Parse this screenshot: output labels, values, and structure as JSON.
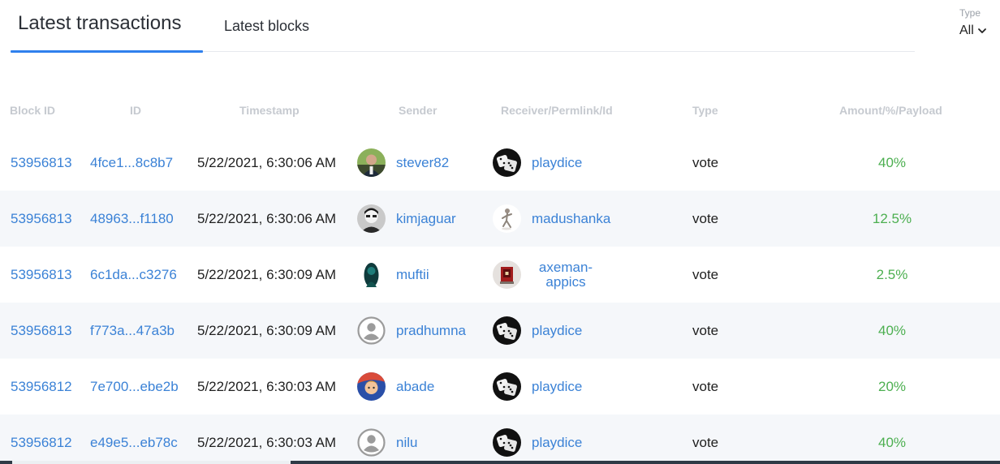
{
  "tabs": {
    "transactions": "Latest transactions",
    "blocks": "Latest blocks"
  },
  "filter": {
    "label": "Type",
    "value": "All"
  },
  "columns": [
    "Block ID",
    "ID",
    "Timestamp",
    "Sender",
    "Receiver/Permlink/Id",
    "Type",
    "Amount/%/Payload"
  ],
  "rows": [
    {
      "block": "53956813",
      "id": "4fce1...8c8b7",
      "time": "5/22/2021, 6:30:06 AM",
      "sender": "stever82",
      "receiver": "playdice",
      "type": "vote",
      "amount": "40%"
    },
    {
      "block": "53956813",
      "id": "48963...f1180",
      "time": "5/22/2021, 6:30:06 AM",
      "sender": "kimjaguar",
      "receiver": "madushanka",
      "type": "vote",
      "amount": "12.5%"
    },
    {
      "block": "53956813",
      "id": "6c1da...c3276",
      "time": "5/22/2021, 6:30:09 AM",
      "sender": "muftii",
      "receiver_line1": "axeman-",
      "receiver_line2": "appics",
      "type": "vote",
      "amount": "2.5%"
    },
    {
      "block": "53956813",
      "id": "f773a...47a3b",
      "time": "5/22/2021, 6:30:09 AM",
      "sender": "pradhumna",
      "receiver": "playdice",
      "type": "vote",
      "amount": "40%"
    },
    {
      "block": "53956812",
      "id": "7e700...ebe2b",
      "time": "5/22/2021, 6:30:03 AM",
      "sender": "abade",
      "receiver": "playdice",
      "type": "vote",
      "amount": "20%"
    },
    {
      "block": "53956812",
      "id": "e49e5...eb78c",
      "time": "5/22/2021, 6:30:03 AM",
      "sender": "nilu",
      "receiver": "playdice",
      "type": "vote",
      "amount": "40%"
    }
  ],
  "colors": {
    "accent": "#2f80ed",
    "link": "#3b82d6",
    "amount": "#4caf50",
    "header": "#c6cad0",
    "row_alt": "#f5f7fa"
  }
}
